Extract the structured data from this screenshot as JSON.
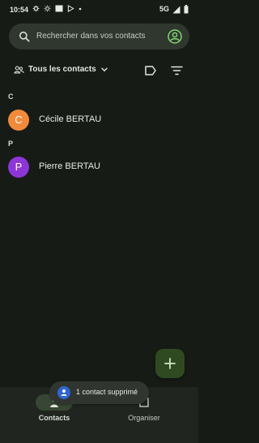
{
  "status_bar": {
    "time": "10:54",
    "network": "5G",
    "icons": [
      "gear-icon",
      "brightness-icon",
      "battery-saver-icon",
      "play-store-icon",
      "dot-icon",
      "signal-icon",
      "battery-icon"
    ]
  },
  "search": {
    "placeholder": "Rechercher dans vos contacts",
    "icon": "search-icon",
    "account_icon": "account-icon"
  },
  "filters": {
    "contacts_label": "Tous les contacts",
    "icons": [
      "people-icon",
      "chevron-down-icon",
      "label-icon",
      "filter-icon"
    ]
  },
  "contacts": {
    "sections": [
      {
        "letter": "C",
        "items": [
          {
            "initial": "C",
            "name": "Cécile BERTAU",
            "avatar_color": "#f28a3b"
          }
        ]
      },
      {
        "letter": "P",
        "items": [
          {
            "initial": "P",
            "name": "Pierre BERTAU",
            "avatar_color": "#8d35d6"
          }
        ]
      }
    ]
  },
  "fab": {
    "icon": "plus-icon",
    "color": "#2f4a21"
  },
  "snackbar": {
    "text": "1 contact supprimé",
    "icon": "person-icon"
  },
  "bottom_nav": {
    "items": [
      {
        "label": "Contacts",
        "icon": "contacts-icon",
        "active": true
      },
      {
        "label": "Organiser",
        "icon": "organize-icon",
        "active": false
      }
    ]
  },
  "colors": {
    "background": "#171b16",
    "surface": "#30372f",
    "nav": "#20251f",
    "accent_pill": "#384735",
    "text": "#e3e6de"
  }
}
